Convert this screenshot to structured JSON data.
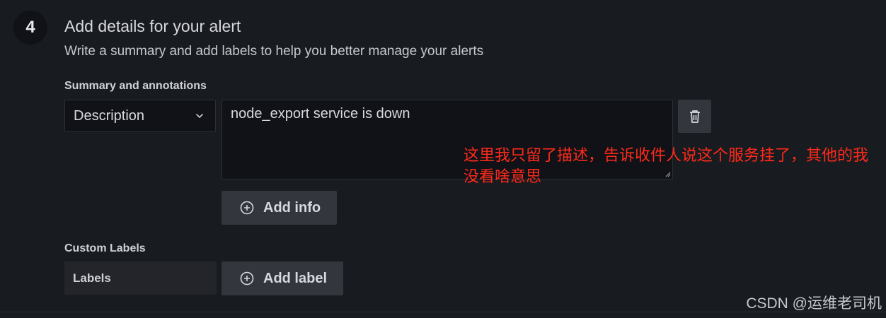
{
  "step": {
    "number": "4",
    "title": "Add details for your alert",
    "subtitle": "Write a summary and add labels to help you better manage your alerts"
  },
  "summary": {
    "label": "Summary and annotations",
    "select_value": "Description",
    "textarea_value": "node_export service is down",
    "add_info_label": "Add info"
  },
  "custom_labels": {
    "label": "Custom Labels",
    "labels_field": "Labels",
    "add_label_label": "Add label"
  },
  "annotation_note": "这里我只留了描述，告诉收件人说这个服务挂了，其他的我没看啥意思",
  "watermark": "CSDN @运维老司机",
  "icons": {
    "select": "chevron-down-icon",
    "delete": "trash-icon",
    "add": "plus-circle-icon"
  },
  "colors": {
    "background": "#181b1f",
    "input_bg": "#111217",
    "button_bg": "#33363d",
    "annotation": "#ff2a1a"
  }
}
